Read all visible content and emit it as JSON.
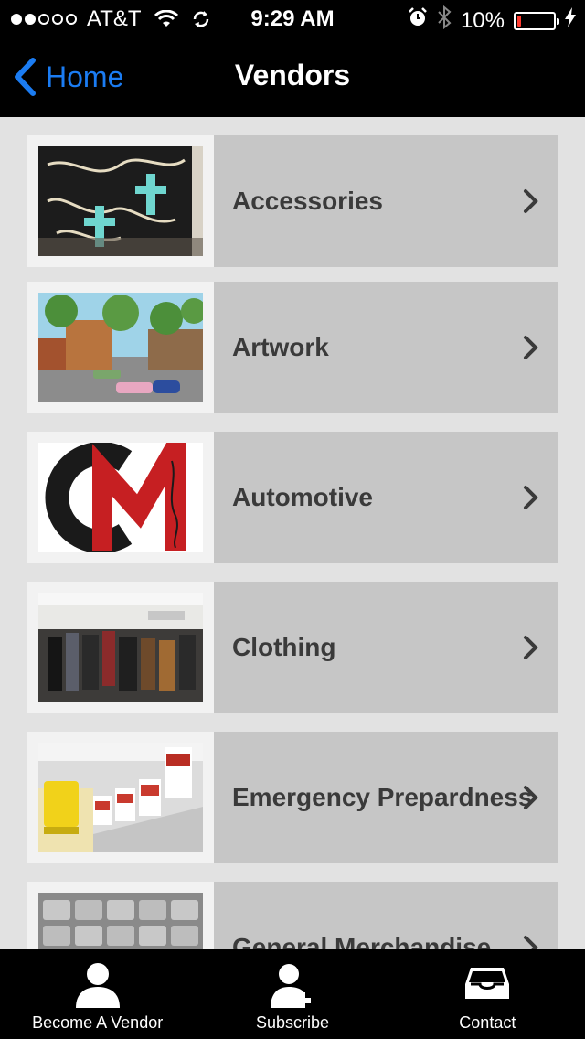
{
  "status_bar": {
    "carrier": "AT&T",
    "time": "9:29 AM",
    "battery": "10%",
    "battery_level": 0.1,
    "signal_bars": 2,
    "battery_color": "#ff3b30"
  },
  "nav": {
    "back_label": "Home",
    "title": "Vendors",
    "accent": "#1b7cf2"
  },
  "vendors": [
    {
      "label": "Accessories",
      "image": "black handbag with turquoise crosses"
    },
    {
      "label": "Artwork",
      "image": "painting of a town street with vintage cars"
    },
    {
      "label": "Automotive",
      "image": "CM logo in black and red"
    },
    {
      "label": "Clothing",
      "image": "clothing racks in a store"
    },
    {
      "label": "Emergency Prepardness",
      "image": "food storage buckets and packages"
    },
    {
      "label": "General Merchandise",
      "image": "rows of metal items"
    }
  ],
  "tab_bar": {
    "tabs": [
      {
        "label": "Become A Vendor",
        "icon": "person-icon"
      },
      {
        "label": "Subscribe",
        "icon": "add-person-icon"
      },
      {
        "label": "Contact",
        "icon": "inbox-icon"
      }
    ]
  }
}
